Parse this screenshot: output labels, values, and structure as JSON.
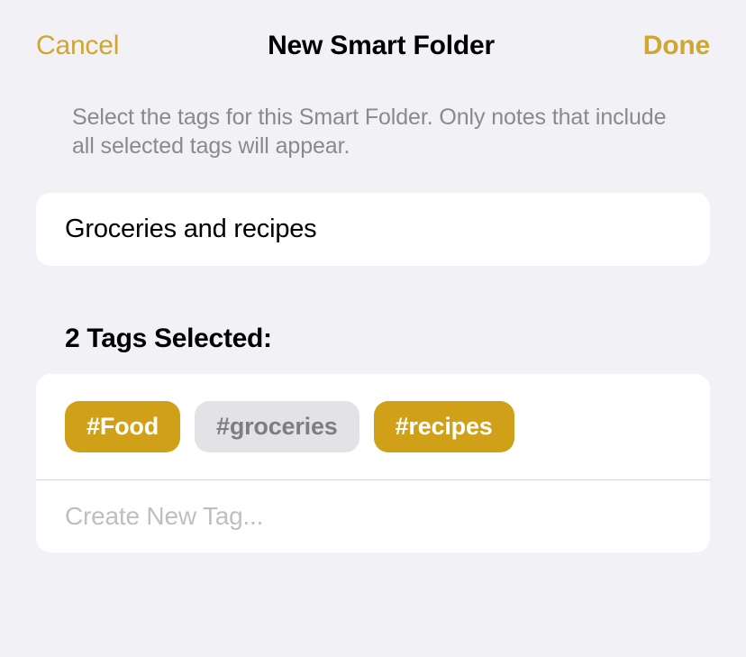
{
  "header": {
    "cancel": "Cancel",
    "title": "New Smart Folder",
    "done": "Done"
  },
  "description": "Select the tags for this Smart Folder. Only notes that include all selected tags will appear.",
  "folderName": "Groceries and recipes",
  "tagsSection": {
    "title": "2 Tags Selected:"
  },
  "tags": [
    {
      "label": "#Food",
      "selected": true
    },
    {
      "label": "#groceries",
      "selected": false
    },
    {
      "label": "#recipes",
      "selected": true
    }
  ],
  "createTag": {
    "placeholder": "Create New Tag..."
  }
}
